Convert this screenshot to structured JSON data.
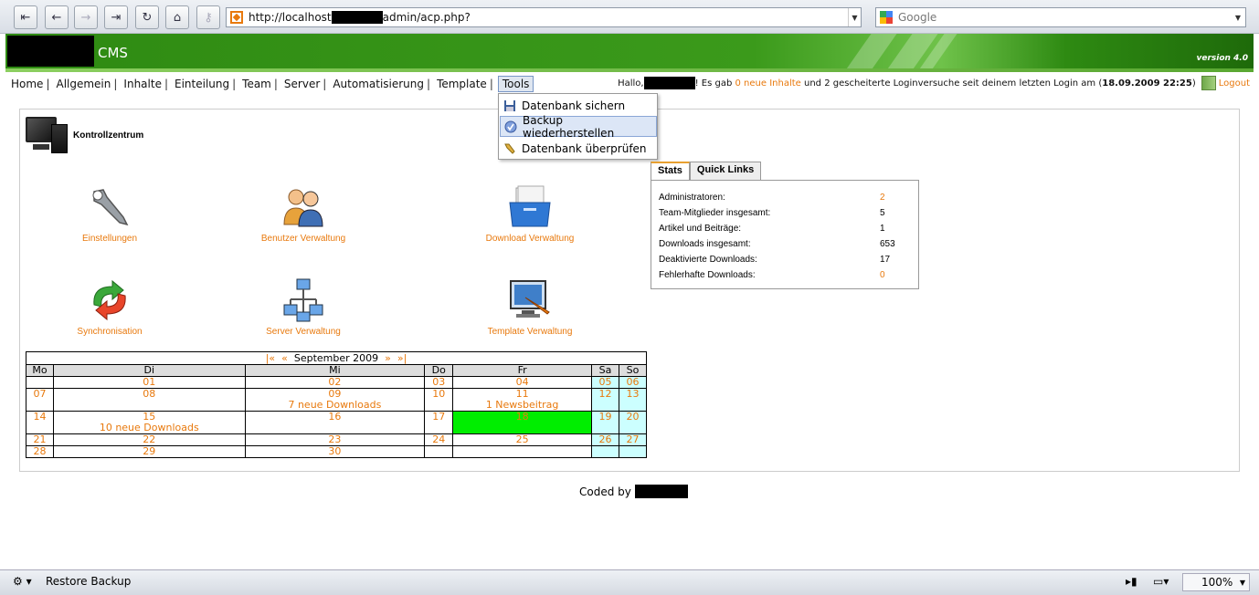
{
  "browser": {
    "url_prefix": "http://localhost",
    "url_suffix": "admin/acp.php?",
    "search_placeholder": "Google"
  },
  "banner": {
    "title": "CMS",
    "version": "version 4.0"
  },
  "nav": {
    "items": [
      "Home",
      "Allgemein",
      "Inhalte",
      "Einteilung",
      "Team",
      "Server",
      "Automatisierung",
      "Template",
      "Tools"
    ],
    "active": "Tools"
  },
  "greeting": {
    "prefix": "Hallo,",
    "middle": "! Es gab",
    "new_content": "0 neue Inhalte",
    "rest": "und 2 gescheiterte Loginversuche seit deinem letzten Login am (",
    "date": "18.09.2009 22:25",
    "close": ")",
    "logout": "Logout"
  },
  "tools_menu": [
    "Datenbank sichern",
    "Backup wiederherstellen",
    "Datenbank überprüfen"
  ],
  "control_center": {
    "title": "Kontrollzentrum"
  },
  "tiles": [
    "Einstellungen",
    "Benutzer Verwaltung",
    "Download Verwaltung",
    "Synchronisation",
    "Server Verwaltung",
    "Template Verwaltung"
  ],
  "stats": {
    "tabs": [
      "Stats",
      "Quick Links"
    ],
    "rows": [
      {
        "label": "Administratoren:",
        "value": "2"
      },
      {
        "label": "Team-Mitglieder insgesamt:",
        "value": "5"
      },
      {
        "label": "Artikel und Beiträge:",
        "value": "1"
      },
      {
        "label": "Downloads insgesamt:",
        "value": "653"
      },
      {
        "label": "Deaktivierte Downloads:",
        "value": "17"
      },
      {
        "label": "Fehlerhafte Downloads:",
        "value": "0"
      }
    ]
  },
  "calendar": {
    "nav_first": "|«",
    "nav_prev": "«",
    "month": "September 2009",
    "nav_next": "»",
    "nav_last": "»|",
    "weekdays": [
      "Mo",
      "Di",
      "Mi",
      "Do",
      "Fr",
      "Sa",
      "So"
    ],
    "weeks": [
      [
        "",
        "01",
        "02",
        "03",
        "04",
        "05",
        "06"
      ],
      [
        "07",
        "08",
        "09",
        "10",
        "11",
        "12",
        "13"
      ],
      [
        "14",
        "15",
        "16",
        "17",
        "18",
        "19",
        "20"
      ],
      [
        "21",
        "22",
        "23",
        "24",
        "25",
        "26",
        "27"
      ],
      [
        "28",
        "29",
        "30",
        "",
        "",
        "",
        ""
      ]
    ],
    "events": {
      "09": "7 neue Downloads",
      "11": "1 Newsbeitrag",
      "15": "10 neue Downloads"
    },
    "today": "18"
  },
  "footer": {
    "coded_by": "Coded by"
  },
  "statusbar": {
    "text": "Restore Backup",
    "zoom": "100%"
  }
}
